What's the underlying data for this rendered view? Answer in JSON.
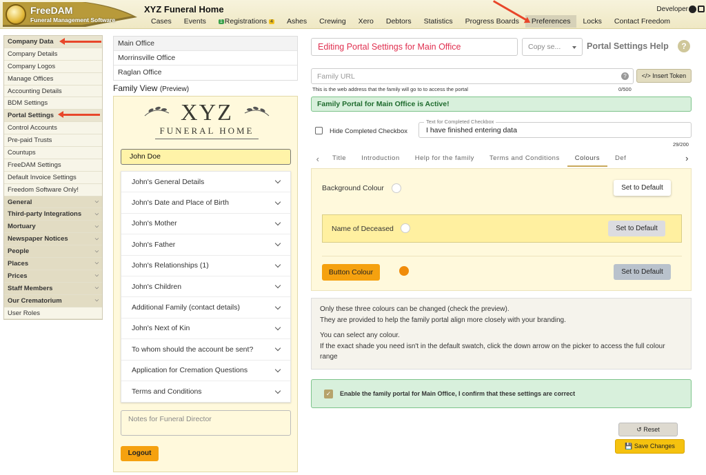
{
  "header": {
    "logo_title": "FreeDAM",
    "logo_subtitle": "Funeral Management Software",
    "app_title": "XYZ Funeral Home",
    "user": "Developer",
    "nav": [
      {
        "label": "Cases"
      },
      {
        "label": "Events"
      },
      {
        "label": "Registrations",
        "badge_left": "1",
        "badge_right": "4"
      },
      {
        "label": "Ashes"
      },
      {
        "label": "Crewing"
      },
      {
        "label": "Xero"
      },
      {
        "label": "Debtors"
      },
      {
        "label": "Statistics"
      },
      {
        "label": "Progress Boards"
      },
      {
        "label": "Preferences",
        "active": true
      },
      {
        "label": "Locks"
      },
      {
        "label": "Contact Freedom"
      }
    ]
  },
  "sidebar": {
    "items": [
      {
        "label": "Company Data",
        "style": "bold"
      },
      {
        "label": "Company Details"
      },
      {
        "label": "Company Logos"
      },
      {
        "label": "Manage Offices"
      },
      {
        "label": "Accounting Details"
      },
      {
        "label": "BDM Settings"
      },
      {
        "label": "Portal Settings",
        "style": "bold"
      },
      {
        "label": "Control Accounts"
      },
      {
        "label": "Pre-paid Trusts"
      },
      {
        "label": "Countups"
      },
      {
        "label": "FreeDAM Settings"
      },
      {
        "label": "Default Invoice Settings"
      },
      {
        "label": "Freedom Software Only!"
      },
      {
        "label": "General",
        "style": "head"
      },
      {
        "label": "Third-party Integrations",
        "style": "head"
      },
      {
        "label": "Mortuary",
        "style": "head"
      },
      {
        "label": "Newspaper Notices",
        "style": "head"
      },
      {
        "label": "People",
        "style": "head"
      },
      {
        "label": "Places",
        "style": "head"
      },
      {
        "label": "Prices",
        "style": "head"
      },
      {
        "label": "Staff Members",
        "style": "head"
      },
      {
        "label": "Our Crematorium",
        "style": "head"
      },
      {
        "label": "User Roles"
      }
    ]
  },
  "offices": [
    "Main Office",
    "Morrinsville Office",
    "Raglan Office"
  ],
  "family_view": {
    "label": "Family View",
    "sub_label": "(Preview)",
    "logo_big": "XYZ",
    "logo_small": "FUNERAL HOME",
    "name_value": "John Doe",
    "sections": [
      "John's General Details",
      "John's Date and Place of Birth",
      "John's Mother",
      "John's Father",
      "John's Relationships (1)",
      "John's Children",
      "Additional Family (contact details)",
      "John's Next of Kin",
      "To whom should the account be sent?",
      "Application for Cremation Questions",
      "Terms and Conditions"
    ],
    "notes_placeholder": "Notes for Funeral Director",
    "logout_label": "Logout"
  },
  "settings": {
    "edit_title": "Editing Portal Settings for Main Office",
    "copy_select": "Copy se...",
    "help_title": "Portal Settings Help",
    "help_icon": "?",
    "family_url_placeholder": "Family URL",
    "insert_token_label": "</> Insert Token",
    "url_hint": "This is the web address that the family will go to to access the portal",
    "url_count": "0/500",
    "active_banner": "Family Portal for Main Office is Active!",
    "hide_completed_label": "Hide Completed Checkbox",
    "completed_legend": "Text for Completed Checkbox",
    "completed_value": "I have finished entering data",
    "completed_count": "29/200",
    "tabs": [
      "Title",
      "Introduction",
      "Help for the family",
      "Terms and Conditions",
      "Colours",
      "Def"
    ],
    "active_tab": "Colours",
    "colours": {
      "background_label": "Background Colour",
      "deceased_label": "Name of Deceased",
      "button_label": "Button Colour",
      "set_default_label": "Set to Default",
      "background_value": "#ffffff",
      "button_value": "#f08c0a"
    },
    "info_lines_1": [
      "Only these three colours can be changed (check the preview).",
      "They are provided to help the family portal align more closely with your branding."
    ],
    "info_lines_2": [
      "You can select any colour.",
      "If the exact shade you need isn't in the default swatch, click the down arrow on the picker to access the full colour range"
    ],
    "confirm_label": "Enable the family portal for Main Office, I confirm that these settings are correct",
    "confirm_checked": true,
    "reset_label": "Reset",
    "save_label": "Save Changes"
  },
  "colors": {
    "accent_orange": "#f5a10f",
    "active_green": "#d8f0dc",
    "title_red": "#e03050",
    "annotation_arrow": "#e8462a"
  }
}
